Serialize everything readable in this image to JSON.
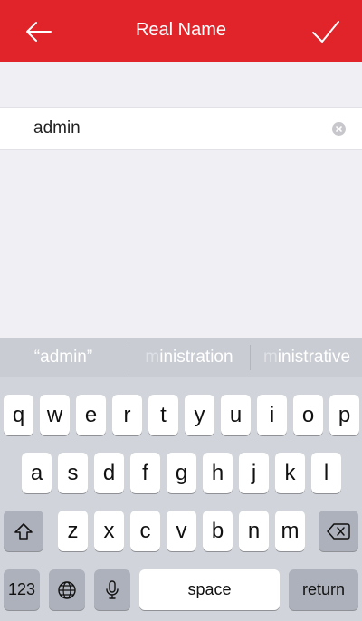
{
  "header": {
    "title": "Real Name",
    "bg_color": "#e0242a",
    "back_icon": "arrow-left-icon",
    "confirm_icon": "checkmark-icon"
  },
  "field": {
    "value": "admin",
    "clear_icon": "clear-circle-icon"
  },
  "suggestions": [
    {
      "label": "“admin”"
    },
    {
      "prefix": "m",
      "rest": "inistration"
    },
    {
      "prefix": "m",
      "rest": "inistrative"
    }
  ],
  "keyboard": {
    "row1": [
      "q",
      "w",
      "e",
      "r",
      "t",
      "y",
      "u",
      "i",
      "o",
      "p"
    ],
    "row2": [
      "a",
      "s",
      "d",
      "f",
      "g",
      "h",
      "j",
      "k",
      "l"
    ],
    "row3": [
      "z",
      "x",
      "c",
      "v",
      "b",
      "n",
      "m"
    ],
    "numbers_label": "123",
    "space_label": "space",
    "return_label": "return",
    "shift_icon": "shift-icon",
    "delete_icon": "backspace-icon",
    "globe_icon": "globe-icon",
    "mic_icon": "microphone-icon"
  }
}
